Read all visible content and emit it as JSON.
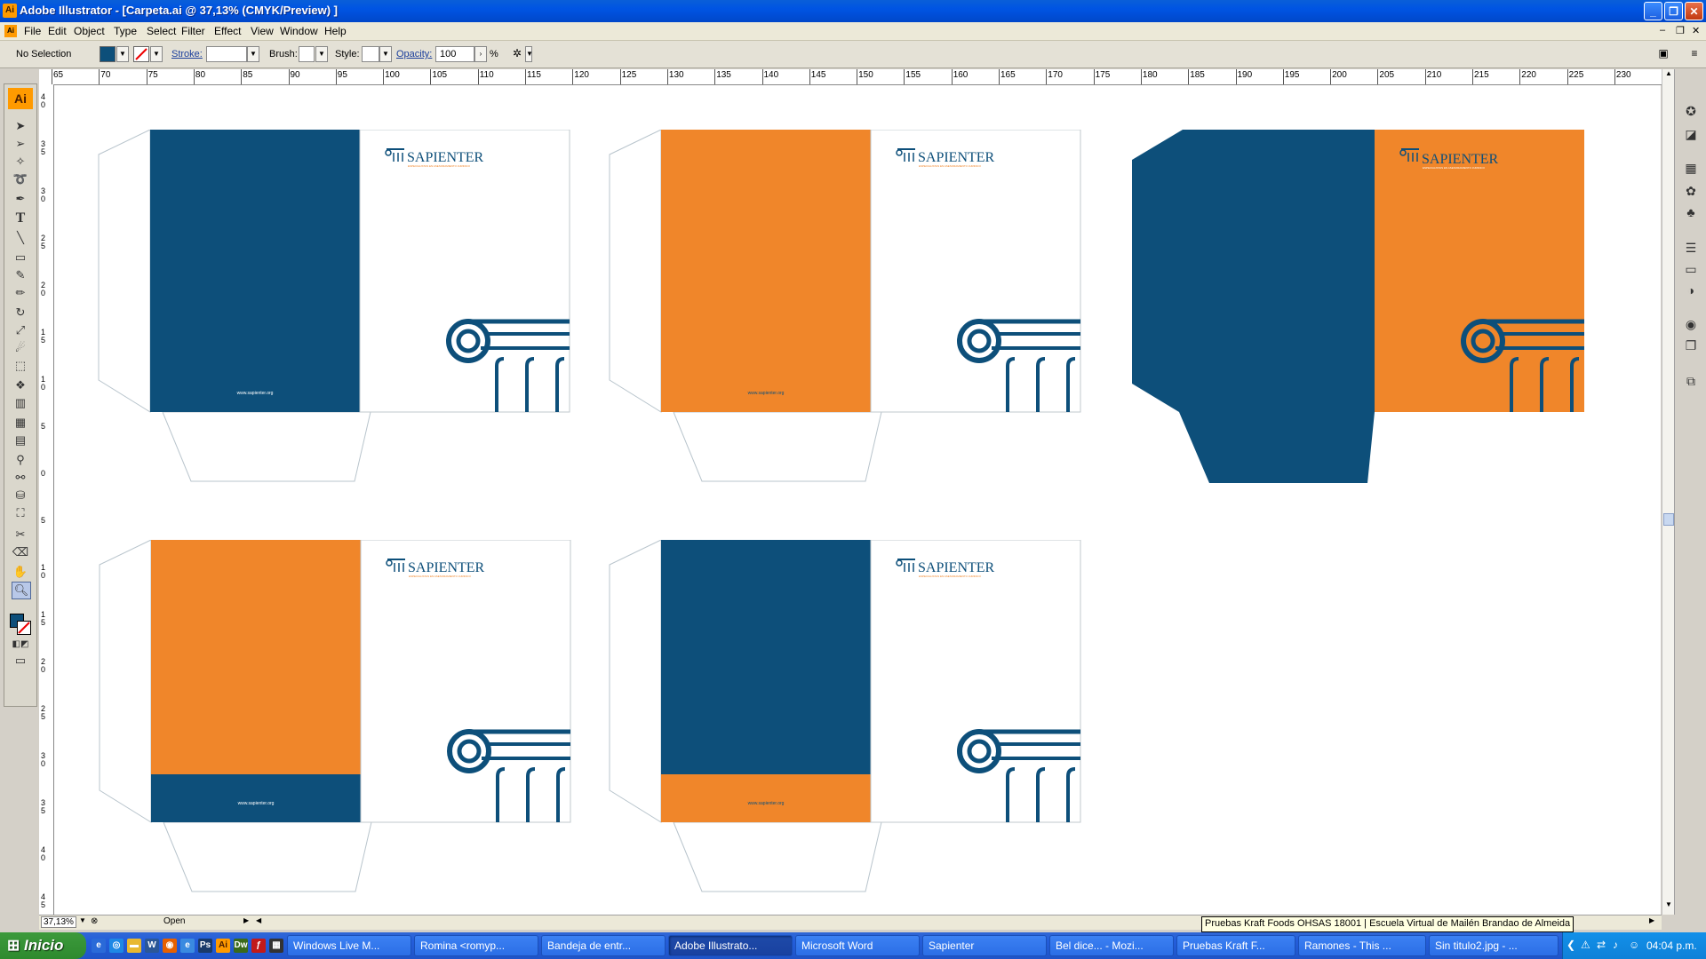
{
  "window": {
    "app_icon": "Ai",
    "title": "Adobe Illustrator - [Carpeta.ai @ 37,13% (CMYK/Preview) ]",
    "buttons": [
      "minimize",
      "restore",
      "close"
    ]
  },
  "menu": [
    "File",
    "Edit",
    "Object",
    "Type",
    "Select",
    "Filter",
    "Effect",
    "View",
    "Window",
    "Help"
  ],
  "control": {
    "selection": "No Selection",
    "fill_color": "#0d4f7a",
    "stroke_label": "Stroke:",
    "brush_label": "Brush:",
    "style_label": "Style:",
    "opacity_label": "Opacity:",
    "opacity_value": "100",
    "percent": "%"
  },
  "tools": {
    "logo": "Ai",
    "icons": [
      "selection-arrow",
      "direct-select",
      "magic-wand",
      "lasso",
      "pen",
      "type",
      "line",
      "rectangle",
      "paintbrush",
      "pencil",
      "rotate",
      "scale",
      "warp",
      "free-transform",
      "symbol-sprayer",
      "graph",
      "mesh",
      "gradient",
      "eyedropper",
      "blend",
      "live-paint",
      "live-paint-select",
      "slice",
      "eraser",
      "hand",
      "zoom"
    ]
  },
  "ruler": {
    "top_labels": [
      "65",
      "70",
      "75",
      "80",
      "85",
      "90",
      "95",
      "100",
      "105",
      "110",
      "115",
      "120",
      "125",
      "130",
      "135",
      "140",
      "145",
      "150",
      "155",
      "160",
      "165",
      "170",
      "175",
      "180",
      "185",
      "190",
      "195",
      "200",
      "205",
      "210",
      "215",
      "220",
      "225",
      "230"
    ],
    "left_labels": [
      "4 0",
      "3 5",
      "3 0",
      "2 5",
      "2 0",
      "1 5",
      "1 0",
      "5",
      "0",
      "5",
      "1 0",
      "1 5",
      "2 0",
      "2 5",
      "3 0",
      "3 5",
      "4 0",
      "4 5"
    ]
  },
  "canvas": {
    "colors": {
      "blue": "#0d4f7a",
      "orange": "#f0862a",
      "white": "#ffffff"
    },
    "folders": [
      {
        "variant": "blue-left-white-right",
        "logo": "SAPIENTER",
        "tagline": "ESPECIALISTAS EN ASESORAMIENTO JURIDICO",
        "url": "www.sapienter.org"
      },
      {
        "variant": "orange-left-white-right",
        "logo": "SAPIENTER",
        "tagline": "ESPECIALISTAS EN ASESORAMIENTO JURIDICO",
        "url": "www.sapienter.org"
      },
      {
        "variant": "blue-flap-orange-right",
        "logo": "SAPIENTER",
        "tagline": "ESPECIALISTAS EN ASESORAMIENTO JURIDICO",
        "url": ""
      },
      {
        "variant": "orange-left-blue-band",
        "logo": "SAPIENTER",
        "tagline": "ESPECIALISTAS EN ASESORAMIENTO JURIDICO",
        "url": "www.sapienter.org"
      },
      {
        "variant": "blue-left-orange-band",
        "logo": "SAPIENTER",
        "tagline": "ESPECIALISTAS EN ASESORAMIENTO JURIDICO",
        "url": "www.sapienter.org"
      }
    ]
  },
  "status": {
    "zoom": "37,13%",
    "status_text": "Open"
  },
  "tooltip": "Pruebas Kraft Foods OHSAS 18001 | Escuela Virtual de Mailén Brandao de Almeida",
  "taskbar": {
    "start_label": "Inicio",
    "quicklaunch": [
      "ie-icon",
      "chrome-icon",
      "folder-icon",
      "word-icon",
      "firefox-icon",
      "ie2-icon",
      "photoshop-icon",
      "illustrator-icon",
      "dreamweaver-icon",
      "flash-icon",
      "calc-icon"
    ],
    "tasks": [
      {
        "label": "Windows Live M...",
        "active": false
      },
      {
        "label": "Romina <romyp...",
        "active": false
      },
      {
        "label": "Bandeja de entr...",
        "active": false
      },
      {
        "label": "Adobe Illustrato...",
        "active": true
      },
      {
        "label": "Microsoft Word",
        "active": false
      },
      {
        "label": "Sapienter",
        "active": false
      },
      {
        "label": "Bel dice... - Mozi...",
        "active": false
      },
      {
        "label": "Pruebas Kraft F...",
        "active": false
      },
      {
        "label": "Ramones - This ...",
        "active": false
      },
      {
        "label": "Sin titulo2.jpg - ...",
        "active": false
      }
    ],
    "clock": "04:04 p.m."
  }
}
